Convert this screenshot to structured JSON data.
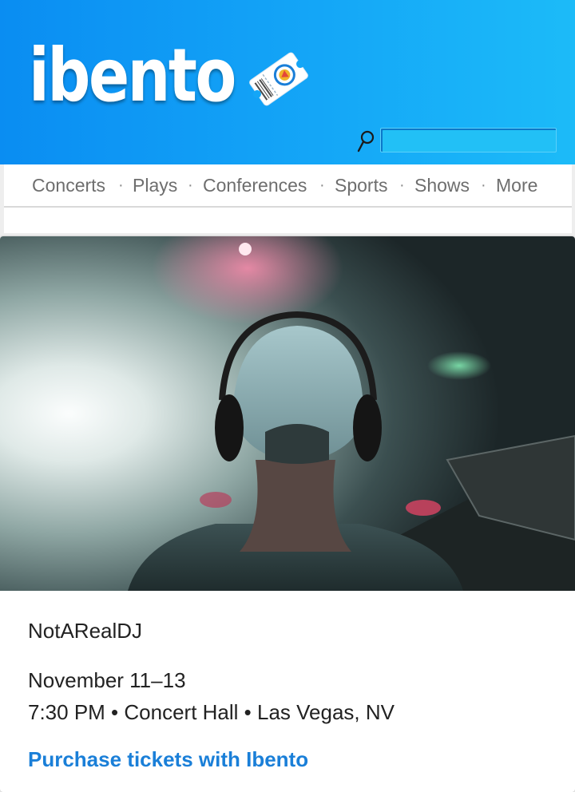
{
  "header": {
    "logo_text": "ibento",
    "logo_icon": "ticket-icon",
    "search": {
      "icon": "search-icon",
      "value": "",
      "placeholder": ""
    }
  },
  "nav": {
    "items": [
      {
        "label": "Concerts"
      },
      {
        "label": "Plays"
      },
      {
        "label": "Conferences"
      },
      {
        "label": "Sports"
      },
      {
        "label": "Shows"
      },
      {
        "label": "More"
      }
    ],
    "separator": "·"
  },
  "event": {
    "image": "dj-wearing-headphones-photo",
    "title": "NotARealDJ",
    "date": "November 11–13",
    "details": "7:30 PM • Concert Hall • Las Vegas, NV",
    "purchase_link": "Purchase tickets with Ibento"
  },
  "colors": {
    "header_gradient_start": "#0a8df2",
    "header_gradient_end": "#1cbbf8",
    "nav_text": "#6e6e6e",
    "link": "#1a7fd8",
    "body_text": "#222222"
  }
}
